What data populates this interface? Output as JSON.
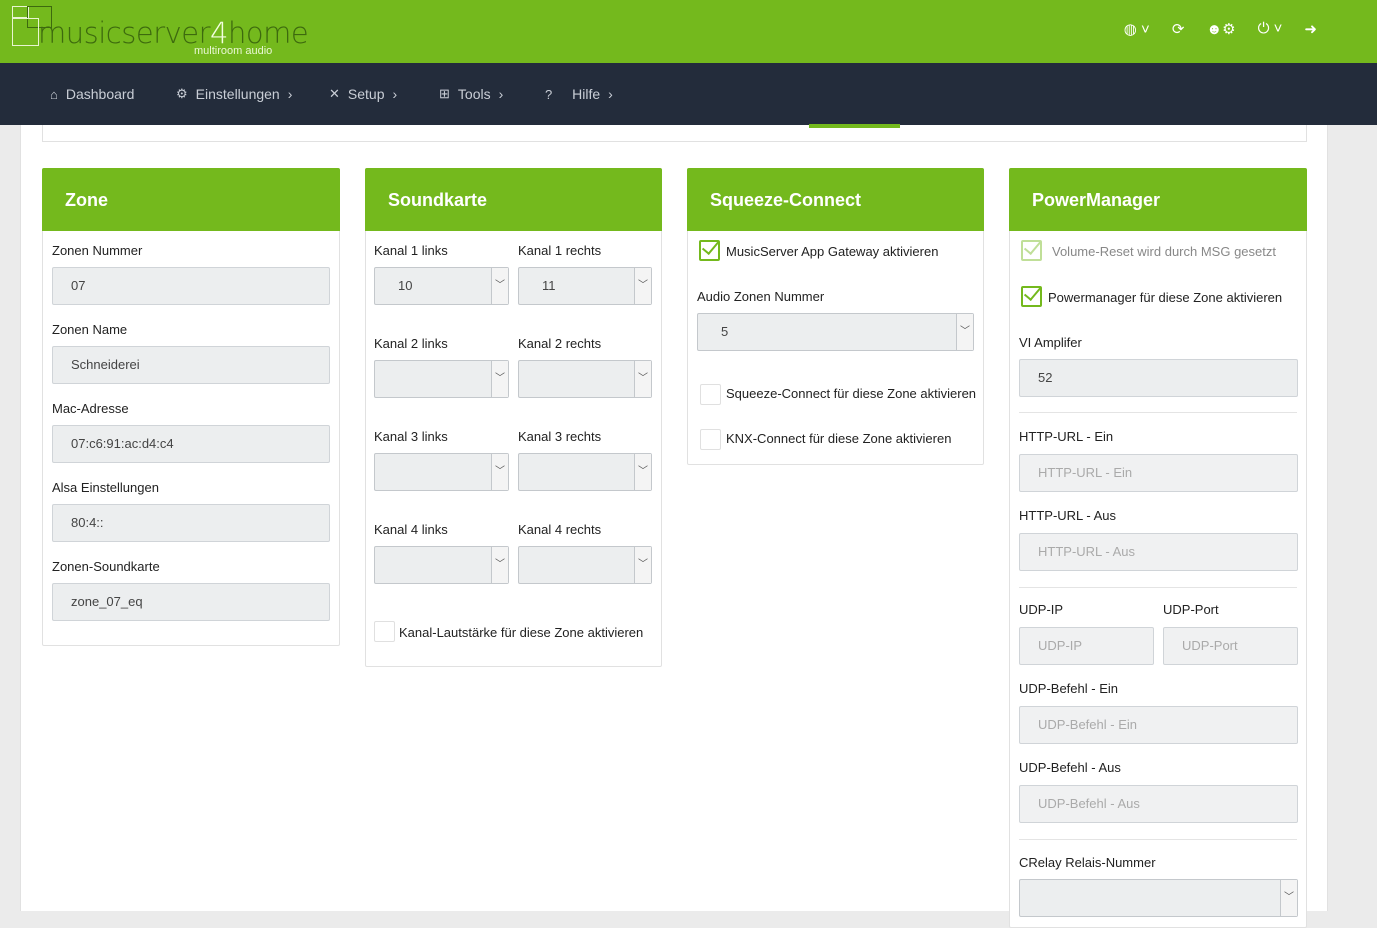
{
  "logo": {
    "name_a": "musicserver",
    "name_b": "4",
    "name_c": "home",
    "tagline": "multiroom audio"
  },
  "header_icons": [
    "globe-icon",
    "refresh-icon",
    "users-gear-icon",
    "power-icon",
    "logout-icon"
  ],
  "nav": {
    "dashboard": "Dashboard",
    "einstellungen": "Einstellungen",
    "setup": "Setup",
    "tools": "Tools",
    "hilfe": "Hilfe",
    "chevron": "›"
  },
  "zone": {
    "title": "Zone",
    "nummer_label": "Zonen Nummer",
    "nummer": "07",
    "name_label": "Zonen Name",
    "name": "Schneiderei",
    "mac_label": "Mac-Adresse",
    "mac": "07:c6:91:ac:d4:c4",
    "alsa_label": "Alsa Einstellungen",
    "alsa": "80:4::",
    "sk_label": "Zonen-Soundkarte",
    "sk": "zone_07_eq"
  },
  "soundkarte": {
    "title": "Soundkarte",
    "k1l": "Kanal 1 links",
    "k1l_val": "10",
    "k1r": "Kanal 1 rechts",
    "k1r_val": "11",
    "k2l": "Kanal 2 links",
    "k2r": "Kanal 2 rechts",
    "k3l": "Kanal 3 links",
    "k3r": "Kanal 3 rechts",
    "k4l": "Kanal 4 links",
    "k4r": "Kanal 4 rechts",
    "volume_cb": "Kanal-Lautstärke für diese Zone aktivieren"
  },
  "squeeze": {
    "title": "Squeeze-Connect",
    "gateway_cb": "MusicServer App Gateway aktivieren",
    "audio_label": "Audio Zonen Nummer",
    "audio_val": "5",
    "squeeze_cb": "Squeeze-Connect für diese Zone aktivieren",
    "knx_cb": "KNX-Connect für diese Zone aktivieren"
  },
  "power": {
    "title": "PowerManager",
    "reset_cb": "Volume-Reset wird durch MSG gesetzt",
    "pm_cb": "Powermanager für diese Zone aktivieren",
    "vi_label": "VI Amplifer",
    "vi_val": "52",
    "http_ein_label": "HTTP-URL - Ein",
    "http_ein_ph": "HTTP-URL - Ein",
    "http_aus_label": "HTTP-URL - Aus",
    "http_aus_ph": "HTTP-URL - Aus",
    "udp_ip_label": "UDP-IP",
    "udp_ip_ph": "UDP-IP",
    "udp_port_label": "UDP-Port",
    "udp_port_ph": "UDP-Port",
    "udp_ein_label": "UDP-Befehl - Ein",
    "udp_ein_ph": "UDP-Befehl - Ein",
    "udp_aus_label": "UDP-Befehl - Aus",
    "udp_aus_ph": "UDP-Befehl - Aus",
    "crelay_label": "CRelay Relais-Nummer"
  }
}
